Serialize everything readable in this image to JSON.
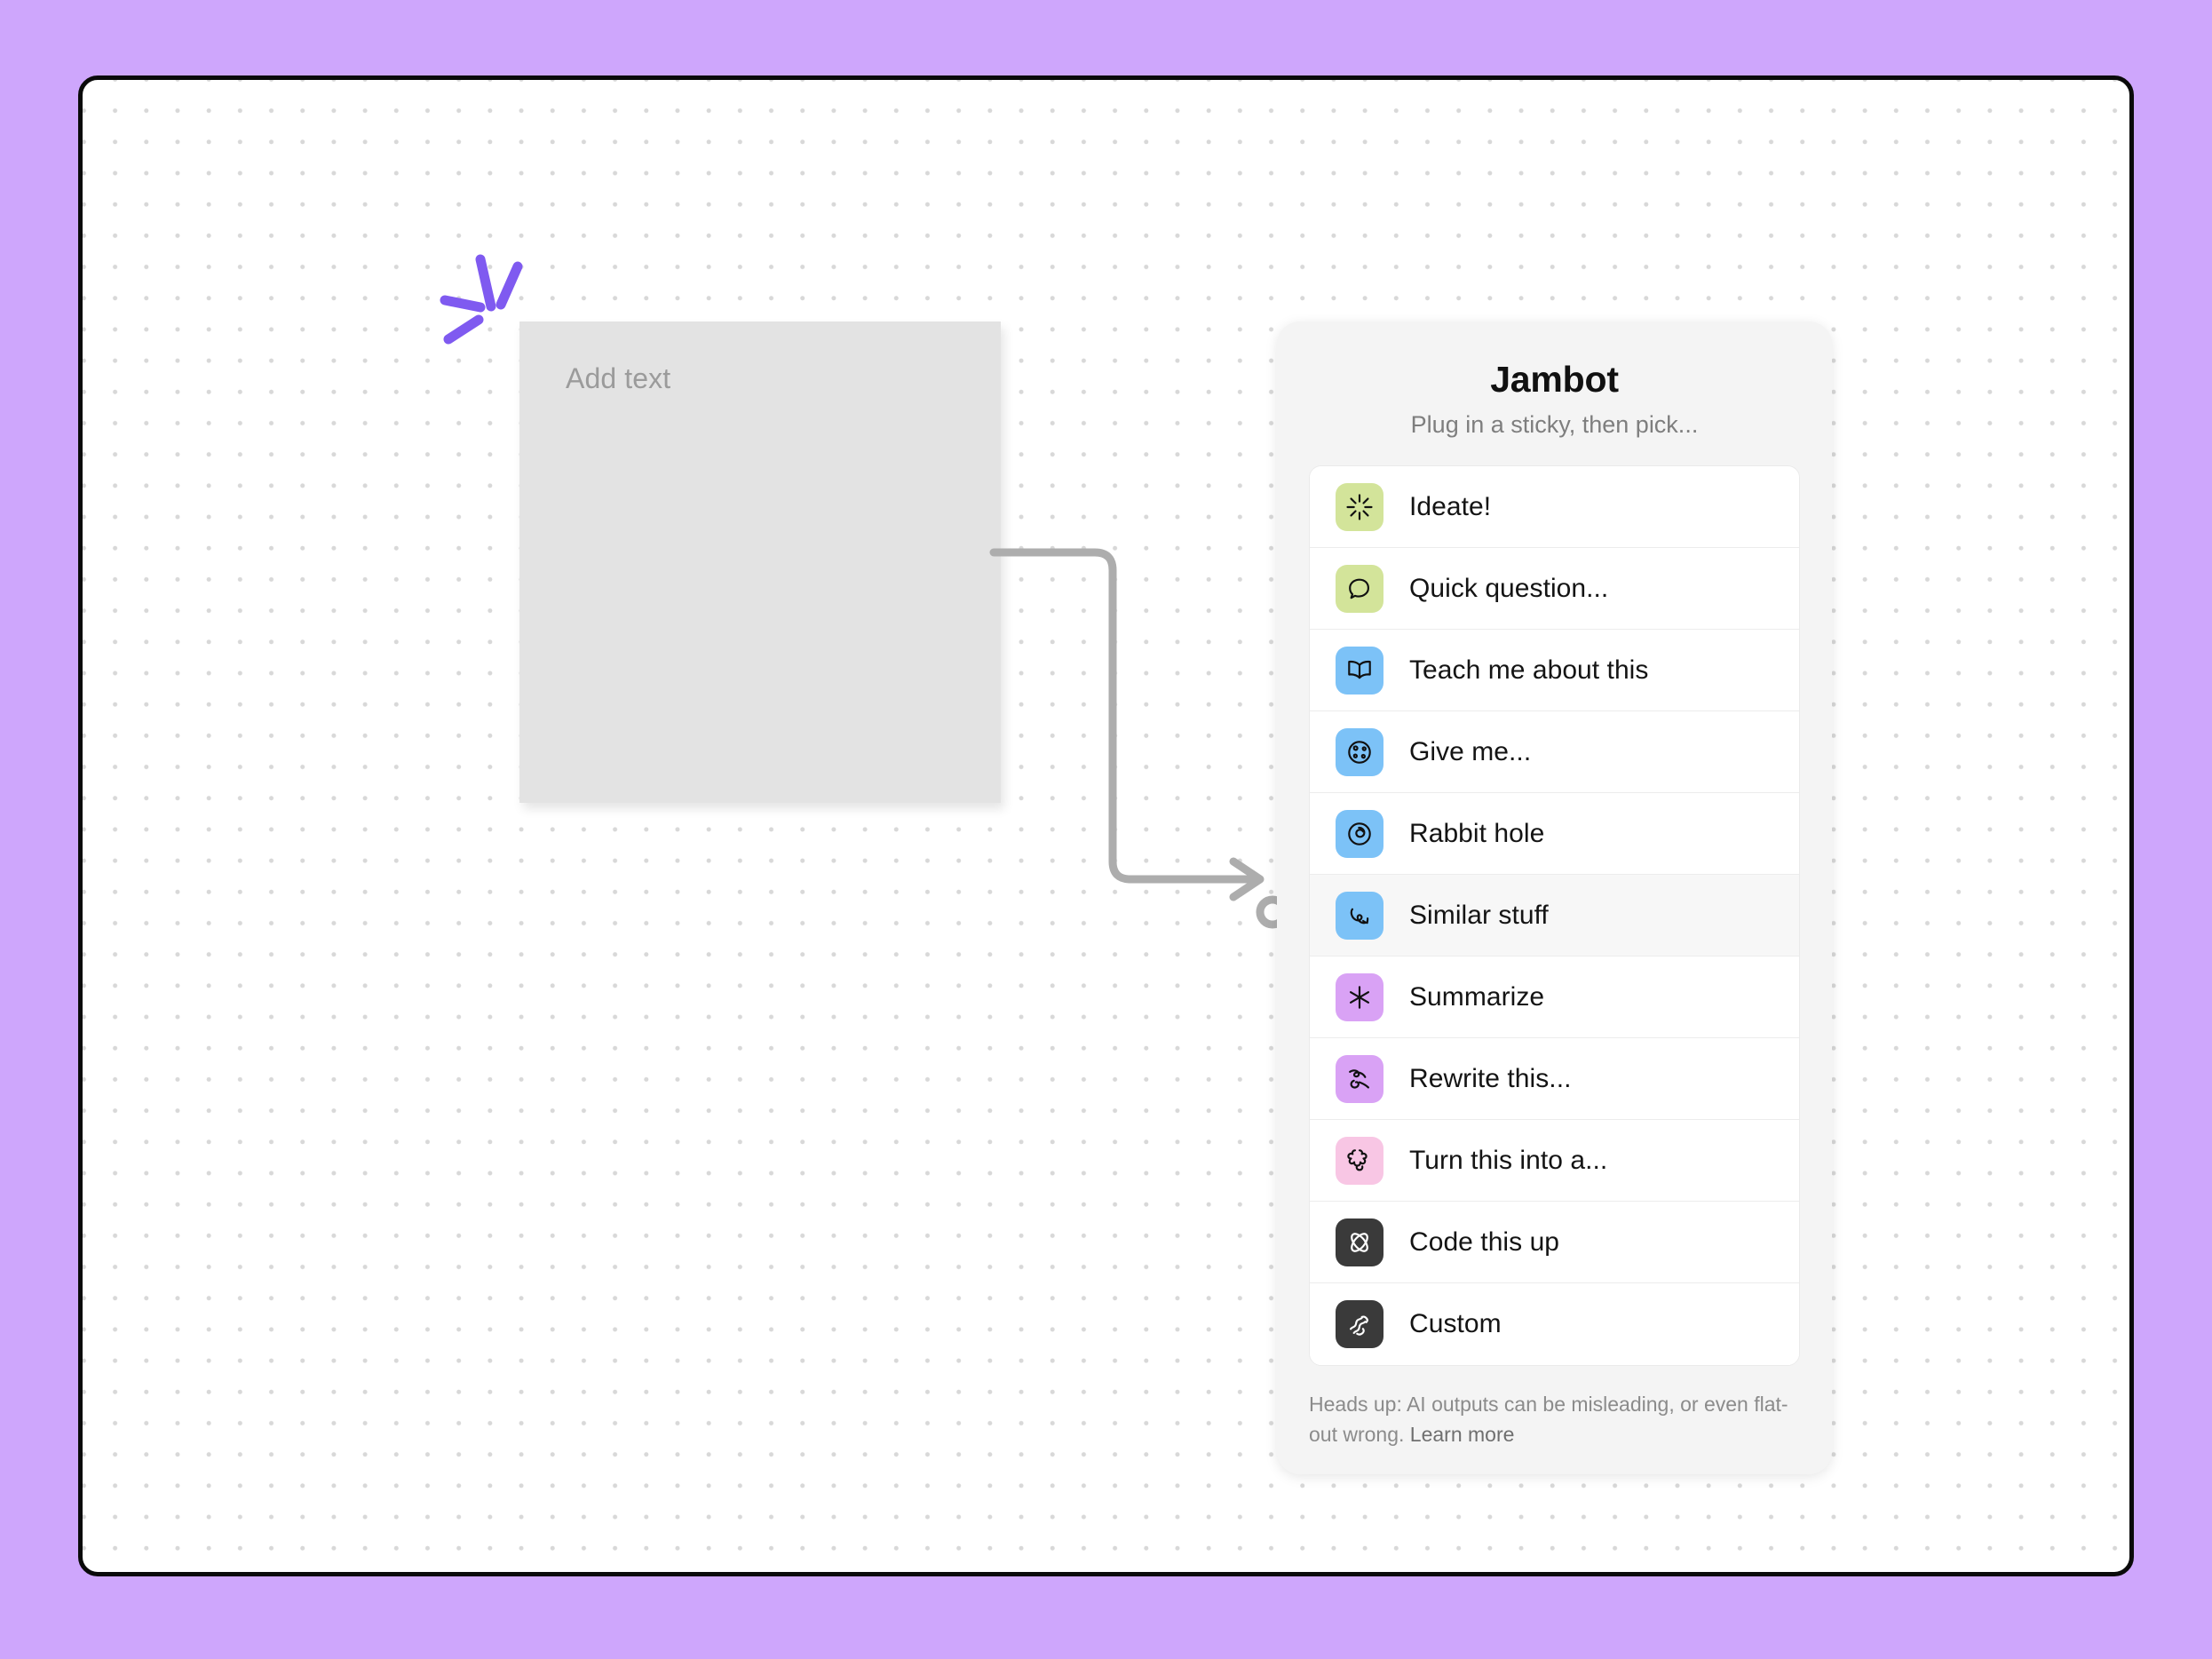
{
  "theme": {
    "page_background": "#cea6fc",
    "canvas_background": "#ffffff",
    "canvas_border": "#0a0a0a",
    "dot_grid": "#d8d8d8",
    "panel_background": "#f4f4f4",
    "list_background": "#ffffff",
    "hover_background": "#f7f7f7",
    "sticky_background": "#e3e3e3",
    "sparkle_accent": "#7f5af0",
    "connector_stroke": "#adadad",
    "swatch_green": "#d3e49a",
    "swatch_blue": "#7cc2f7",
    "swatch_purple": "#d9a2f5",
    "swatch_pink": "#f8c6e4",
    "swatch_dark": "#3a3a3a"
  },
  "sticky": {
    "placeholder": "Add text",
    "name": "sticky-note"
  },
  "sparkle": {
    "icon": "sparkle-burst-icon"
  },
  "connector": {
    "icon": "connector-arrow",
    "port_icon": "connection-port-icon"
  },
  "panel": {
    "title": "Jambot",
    "subtitle": "Plug in a sticky, then pick...",
    "items": [
      {
        "label": "Ideate!",
        "icon": "sparkle-burst-icon",
        "swatch": "#d3e49a",
        "glyph_color": "#111111",
        "hovered": false
      },
      {
        "label": "Quick question...",
        "icon": "speech-bubble-icon",
        "swatch": "#d3e49a",
        "glyph_color": "#111111",
        "hovered": false
      },
      {
        "label": "Teach me about this",
        "icon": "open-book-icon",
        "swatch": "#7cc2f7",
        "glyph_color": "#111111",
        "hovered": false
      },
      {
        "label": "Give me...",
        "icon": "cookie-icon",
        "swatch": "#7cc2f7",
        "glyph_color": "#111111",
        "hovered": false
      },
      {
        "label": "Rabbit hole",
        "icon": "spiral-icon",
        "swatch": "#7cc2f7",
        "glyph_color": "#111111",
        "hovered": false
      },
      {
        "label": "Similar stuff",
        "icon": "curved-arrow-icon",
        "swatch": "#7cc2f7",
        "glyph_color": "#111111",
        "hovered": true
      },
      {
        "label": "Summarize",
        "icon": "asterisk-icon",
        "swatch": "#d9a2f5",
        "glyph_color": "#111111",
        "hovered": false
      },
      {
        "label": "Rewrite this...",
        "icon": "squiggle-icon",
        "swatch": "#d9a2f5",
        "glyph_color": "#111111",
        "hovered": false
      },
      {
        "label": "Turn this into a...",
        "icon": "flower-icon",
        "swatch": "#f8c6e4",
        "glyph_color": "#111111",
        "hovered": false
      },
      {
        "label": "Code this up",
        "icon": "atom-orbit-icon",
        "swatch": "#3a3a3a",
        "glyph_color": "#ffffff",
        "hovered": false
      },
      {
        "label": "Custom",
        "icon": "zigzag-scribble-icon",
        "swatch": "#3a3a3a",
        "glyph_color": "#ffffff",
        "hovered": false
      }
    ],
    "footer": {
      "text": "Heads up: AI outputs can be misleading, or even flat-out wrong. ",
      "link_label": "Learn more"
    }
  }
}
